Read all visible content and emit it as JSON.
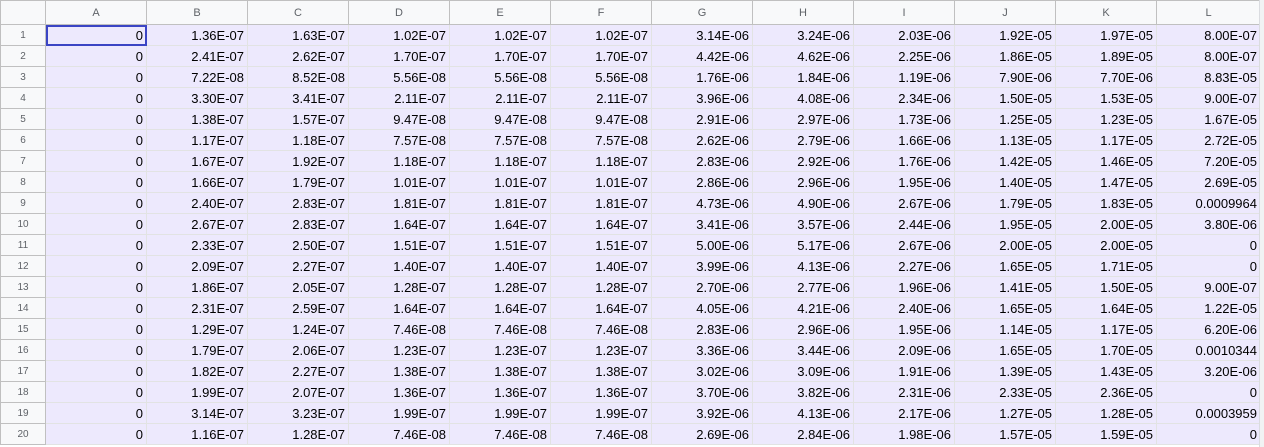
{
  "columns": [
    "A",
    "B",
    "C",
    "D",
    "E",
    "F",
    "G",
    "H",
    "I",
    "J",
    "K",
    "L"
  ],
  "selected_cell": "A1",
  "colors": {
    "cell_fill": "#ede9fd",
    "header_fill": "#f8f9fa",
    "selection": "#3b45c4"
  },
  "rows": [
    {
      "n": "1",
      "cells": [
        "0",
        "1.36E-07",
        "1.63E-07",
        "1.02E-07",
        "1.02E-07",
        "1.02E-07",
        "3.14E-06",
        "3.24E-06",
        "2.03E-06",
        "1.92E-05",
        "1.97E-05",
        "8.00E-07"
      ]
    },
    {
      "n": "2",
      "cells": [
        "0",
        "2.41E-07",
        "2.62E-07",
        "1.70E-07",
        "1.70E-07",
        "1.70E-07",
        "4.42E-06",
        "4.62E-06",
        "2.25E-06",
        "1.86E-05",
        "1.89E-05",
        "8.00E-07"
      ]
    },
    {
      "n": "3",
      "cells": [
        "0",
        "7.22E-08",
        "8.52E-08",
        "5.56E-08",
        "5.56E-08",
        "5.56E-08",
        "1.76E-06",
        "1.84E-06",
        "1.19E-06",
        "7.90E-06",
        "7.70E-06",
        "8.83E-05"
      ]
    },
    {
      "n": "4",
      "cells": [
        "0",
        "3.30E-07",
        "3.41E-07",
        "2.11E-07",
        "2.11E-07",
        "2.11E-07",
        "3.96E-06",
        "4.08E-06",
        "2.34E-06",
        "1.50E-05",
        "1.53E-05",
        "9.00E-07"
      ]
    },
    {
      "n": "5",
      "cells": [
        "0",
        "1.38E-07",
        "1.57E-07",
        "9.47E-08",
        "9.47E-08",
        "9.47E-08",
        "2.91E-06",
        "2.97E-06",
        "1.73E-06",
        "1.25E-05",
        "1.23E-05",
        "1.67E-05"
      ]
    },
    {
      "n": "6",
      "cells": [
        "0",
        "1.17E-07",
        "1.18E-07",
        "7.57E-08",
        "7.57E-08",
        "7.57E-08",
        "2.62E-06",
        "2.79E-06",
        "1.66E-06",
        "1.13E-05",
        "1.17E-05",
        "2.72E-05"
      ]
    },
    {
      "n": "7",
      "cells": [
        "0",
        "1.67E-07",
        "1.92E-07",
        "1.18E-07",
        "1.18E-07",
        "1.18E-07",
        "2.83E-06",
        "2.92E-06",
        "1.76E-06",
        "1.42E-05",
        "1.46E-05",
        "7.20E-05"
      ]
    },
    {
      "n": "8",
      "cells": [
        "0",
        "1.66E-07",
        "1.79E-07",
        "1.01E-07",
        "1.01E-07",
        "1.01E-07",
        "2.86E-06",
        "2.96E-06",
        "1.95E-06",
        "1.40E-05",
        "1.47E-05",
        "2.69E-05"
      ]
    },
    {
      "n": "9",
      "cells": [
        "0",
        "2.40E-07",
        "2.83E-07",
        "1.81E-07",
        "1.81E-07",
        "1.81E-07",
        "4.73E-06",
        "4.90E-06",
        "2.67E-06",
        "1.79E-05",
        "1.83E-05",
        "0.0009964"
      ]
    },
    {
      "n": "10",
      "cells": [
        "0",
        "2.67E-07",
        "2.83E-07",
        "1.64E-07",
        "1.64E-07",
        "1.64E-07",
        "3.41E-06",
        "3.57E-06",
        "2.44E-06",
        "1.95E-05",
        "2.00E-05",
        "3.80E-06"
      ]
    },
    {
      "n": "11",
      "cells": [
        "0",
        "2.33E-07",
        "2.50E-07",
        "1.51E-07",
        "1.51E-07",
        "1.51E-07",
        "5.00E-06",
        "5.17E-06",
        "2.67E-06",
        "2.00E-05",
        "2.00E-05",
        "0"
      ]
    },
    {
      "n": "12",
      "cells": [
        "0",
        "2.09E-07",
        "2.27E-07",
        "1.40E-07",
        "1.40E-07",
        "1.40E-07",
        "3.99E-06",
        "4.13E-06",
        "2.27E-06",
        "1.65E-05",
        "1.71E-05",
        "0"
      ]
    },
    {
      "n": "13",
      "cells": [
        "0",
        "1.86E-07",
        "2.05E-07",
        "1.28E-07",
        "1.28E-07",
        "1.28E-07",
        "2.70E-06",
        "2.77E-06",
        "1.96E-06",
        "1.41E-05",
        "1.50E-05",
        "9.00E-07"
      ]
    },
    {
      "n": "14",
      "cells": [
        "0",
        "2.31E-07",
        "2.59E-07",
        "1.64E-07",
        "1.64E-07",
        "1.64E-07",
        "4.05E-06",
        "4.21E-06",
        "2.40E-06",
        "1.65E-05",
        "1.64E-05",
        "1.22E-05"
      ]
    },
    {
      "n": "15",
      "cells": [
        "0",
        "1.29E-07",
        "1.24E-07",
        "7.46E-08",
        "7.46E-08",
        "7.46E-08",
        "2.83E-06",
        "2.96E-06",
        "1.95E-06",
        "1.14E-05",
        "1.17E-05",
        "6.20E-06"
      ]
    },
    {
      "n": "16",
      "cells": [
        "0",
        "1.79E-07",
        "2.06E-07",
        "1.23E-07",
        "1.23E-07",
        "1.23E-07",
        "3.36E-06",
        "3.44E-06",
        "2.09E-06",
        "1.65E-05",
        "1.70E-05",
        "0.0010344"
      ]
    },
    {
      "n": "17",
      "cells": [
        "0",
        "1.82E-07",
        "2.27E-07",
        "1.38E-07",
        "1.38E-07",
        "1.38E-07",
        "3.02E-06",
        "3.09E-06",
        "1.91E-06",
        "1.39E-05",
        "1.43E-05",
        "3.20E-06"
      ]
    },
    {
      "n": "18",
      "cells": [
        "0",
        "1.99E-07",
        "2.07E-07",
        "1.36E-07",
        "1.36E-07",
        "1.36E-07",
        "3.70E-06",
        "3.82E-06",
        "2.31E-06",
        "2.33E-05",
        "2.36E-05",
        "0"
      ]
    },
    {
      "n": "19",
      "cells": [
        "0",
        "3.14E-07",
        "3.23E-07",
        "1.99E-07",
        "1.99E-07",
        "1.99E-07",
        "3.92E-06",
        "4.13E-06",
        "2.17E-06",
        "1.27E-05",
        "1.28E-05",
        "0.0003959"
      ]
    },
    {
      "n": "20",
      "cells": [
        "0",
        "1.16E-07",
        "1.28E-07",
        "7.46E-08",
        "7.46E-08",
        "7.46E-08",
        "2.69E-06",
        "2.84E-06",
        "1.98E-06",
        "1.57E-05",
        "1.59E-05",
        "0"
      ]
    }
  ]
}
